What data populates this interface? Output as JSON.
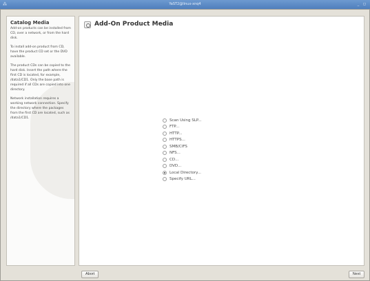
{
  "titlebar": {
    "menu_glyph": "⁂",
    "title": "YaST2@linux-xnq4",
    "controls": "_ ◻"
  },
  "help": {
    "title": "Catalog Media",
    "paragraphs": [
      "Add-on products can be installed from CD, over a network, or from the hard disk.",
      "To install add-on product from CD, have the product CD set or the DVD available.",
      "The product CDs can be copied to the hard disk. Insert the path where the first CD is located, for example, /data1/CD1. Only the base path is required if all CDs are copied into one directory.",
      "Network installation requires a working network connection. Specify the directory where the packages from the first CD are located, such as /data1/CD1."
    ]
  },
  "main": {
    "title": "Add-On Product Media",
    "options": [
      {
        "label": "Scan Using SLP...",
        "checked": false
      },
      {
        "label": "FTP...",
        "checked": false
      },
      {
        "label": "HTTP...",
        "checked": false
      },
      {
        "label": "HTTPS...",
        "checked": false
      },
      {
        "label": "SMB/CIFS",
        "checked": false
      },
      {
        "label": "NFS...",
        "checked": false
      },
      {
        "label": "CD...",
        "checked": false
      },
      {
        "label": "DVD...",
        "checked": false
      },
      {
        "label": "Local Directory...",
        "checked": true
      },
      {
        "label": "Specify URL...",
        "checked": false
      }
    ]
  },
  "buttons": {
    "abort": "Abort",
    "next": "Next"
  }
}
